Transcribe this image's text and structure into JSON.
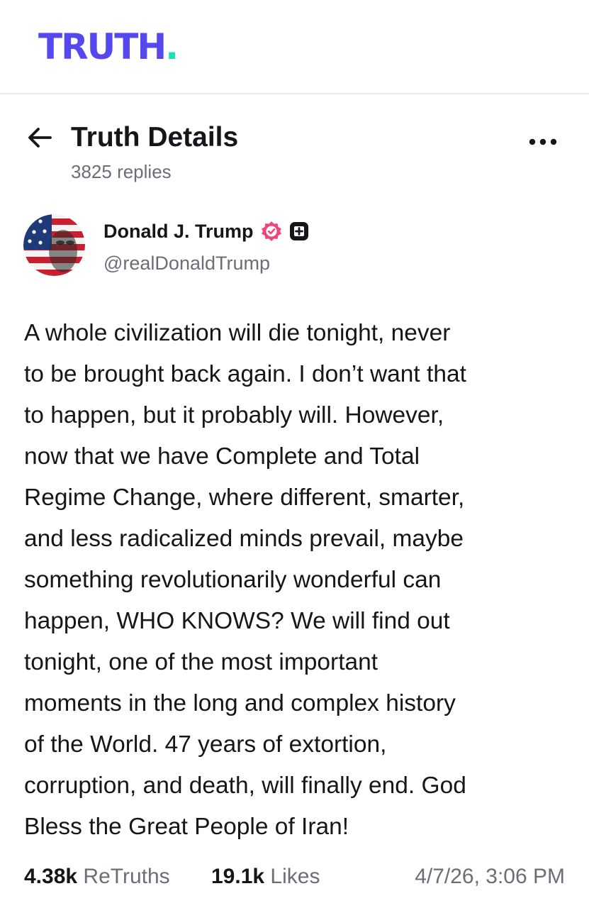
{
  "brand": {
    "logo_text": "TRUTH",
    "logo_dot": ".",
    "logo_color": "#5448ee",
    "dot_color": "#17e3b0"
  },
  "header": {
    "title": "Truth Details",
    "replies": "3825 replies",
    "back_icon": "arrow-left-icon",
    "more_icon": "more-horizontal-icon"
  },
  "author": {
    "name": "Donald J. Trump",
    "handle": "@realDonaldTrump",
    "verified_icon": "verified-badge-icon",
    "verified_color": "#f0457c",
    "plus_icon": "plus-badge-icon"
  },
  "post": {
    "lines": [
      "A whole civilization will die tonight, never",
      "to be brought back again. I don’t want that",
      "to happen, but it probably will. However,",
      "now that we have Complete and Total",
      "Regime Change, where different, smarter,",
      "and less radicalized minds prevail, maybe",
      "something revolutionarily wonderful can",
      "happen, WHO KNOWS? We will find out",
      "tonight, one of the most important",
      "moments in the long and complex history",
      "of the World. 47 years of extortion,",
      "corruption, and death, will finally end. God",
      "Bless the Great People of Iran!"
    ]
  },
  "stats": {
    "retruths_count": "4.38k",
    "retruths_label": "ReTruths",
    "likes_count": "19.1k",
    "likes_label": "Likes",
    "timestamp": "4/7/26, 3:06 PM"
  }
}
